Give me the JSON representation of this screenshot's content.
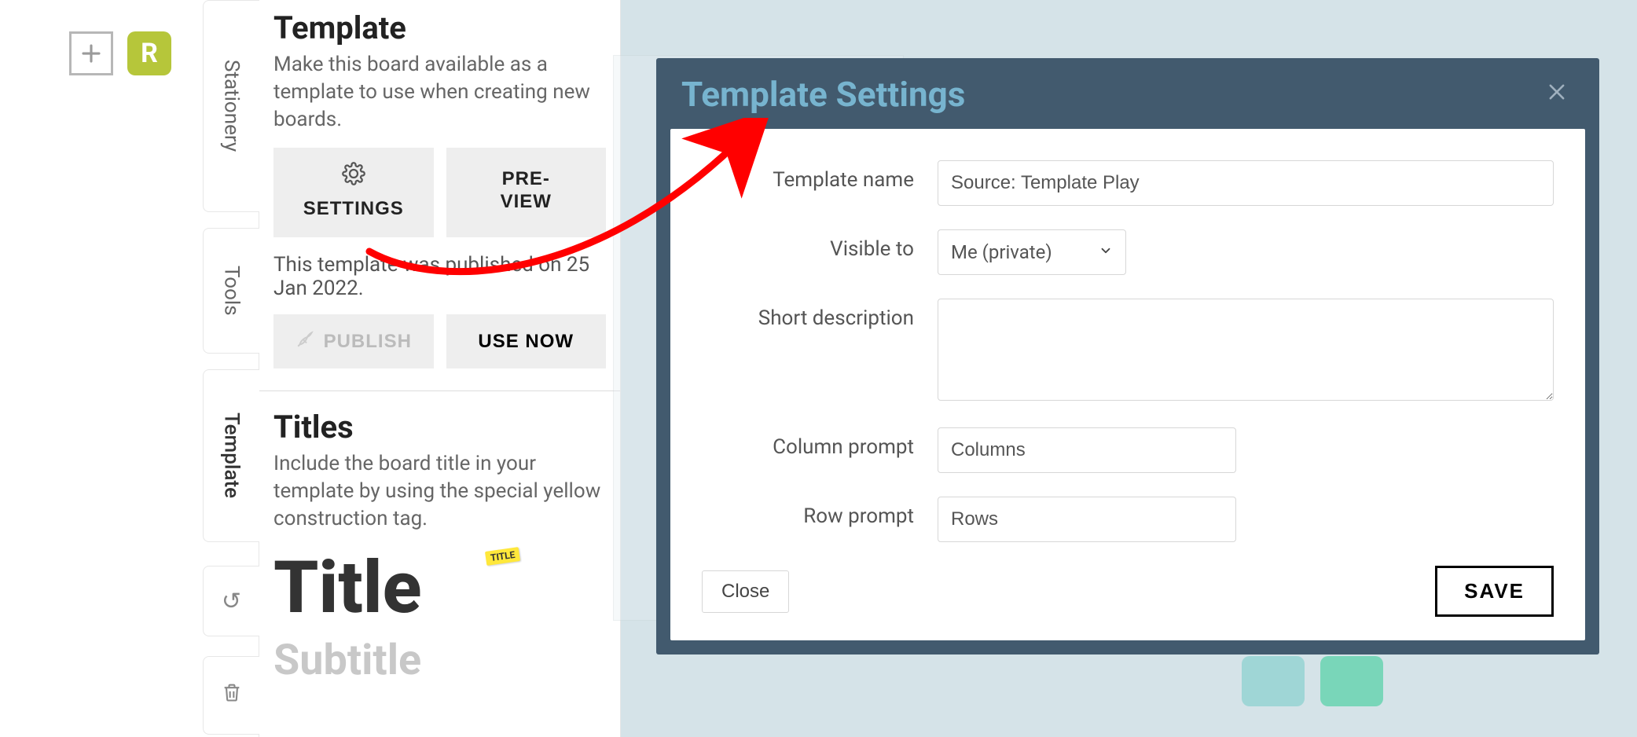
{
  "rail": {
    "avatar_letter": "R"
  },
  "tabs": {
    "stationery": "Stationery",
    "tools": "Tools",
    "template": "Template"
  },
  "panel": {
    "template": {
      "title": "Template",
      "desc": "Make this board available as a template to use when creating new boards.",
      "settings_btn": "SETTINGS",
      "preview_btn_l1": "PRE-",
      "preview_btn_l2": "VIEW",
      "status": "This template was published on 25 Jan 2022.",
      "publish_btn": "PUBLISH",
      "usenow_btn": "USE NOW"
    },
    "titles": {
      "title": "Titles",
      "desc": "Include the board title in your template by using the special yellow construction tag.",
      "title_display": "Title",
      "title_tag": "TITLE",
      "subtitle_display": "Subtitle"
    }
  },
  "dialog": {
    "title": "Template Settings",
    "labels": {
      "name": "Template name",
      "visible": "Visible to",
      "desc": "Short description",
      "col": "Column prompt",
      "row": "Row prompt"
    },
    "values": {
      "name": "Source: Template Play",
      "visible": "Me (private)",
      "desc": "",
      "col": "Columns",
      "row": "Rows"
    },
    "close_btn": "Close",
    "save_btn": "SAVE"
  }
}
